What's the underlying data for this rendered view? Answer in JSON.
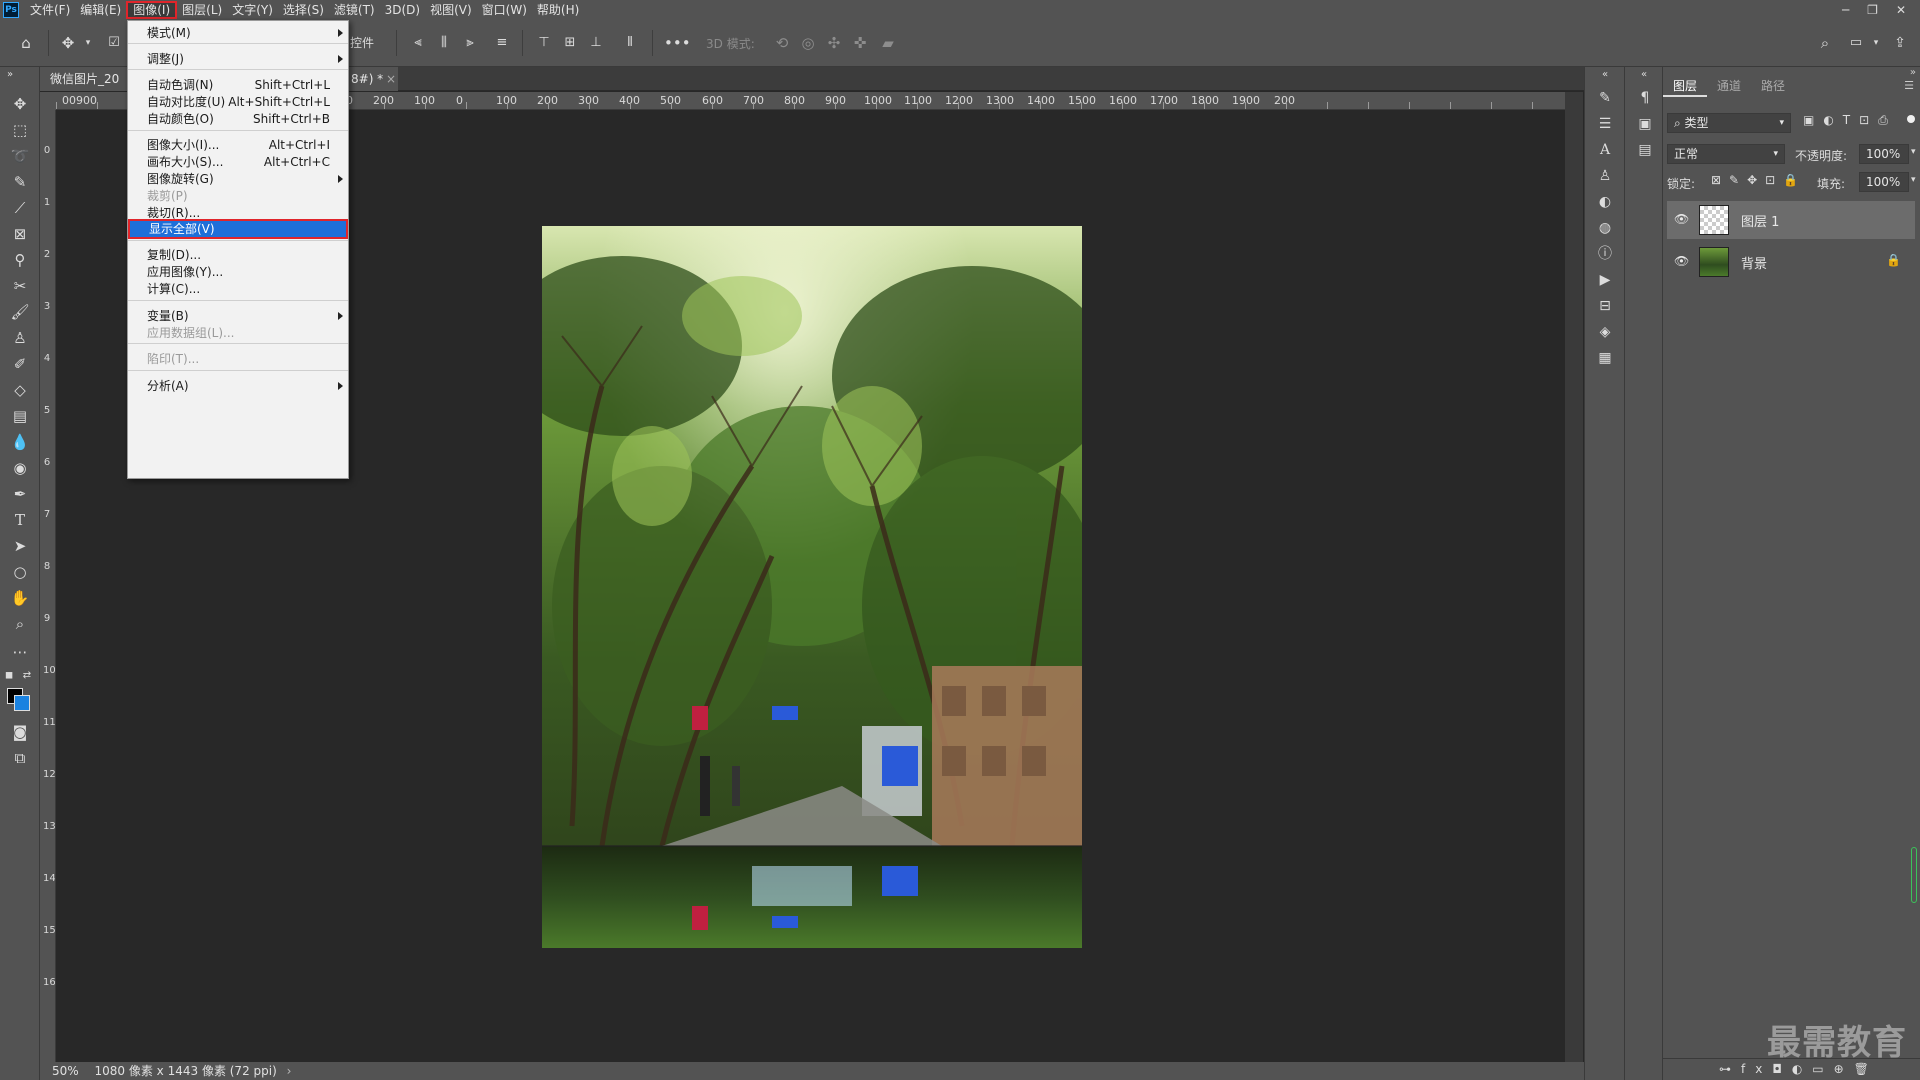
{
  "app": {
    "logo": "Ps"
  },
  "menubar": {
    "items": [
      "文件(F)",
      "编辑(E)",
      "图像(I)",
      "图层(L)",
      "文字(Y)",
      "选择(S)",
      "滤镜(T)",
      "3D(D)",
      "视图(V)",
      "窗口(W)",
      "帮助(H)"
    ],
    "active": "图像(I)"
  },
  "window_controls": {
    "minimize": "─",
    "restore": "❐",
    "close": "✕"
  },
  "options": {
    "partial_label": "控件",
    "mode3d_label": "3D 模式:",
    "more": "•••"
  },
  "tab": {
    "title": "微信图片_20"
  },
  "tab_partial": {
    "suffix": "8#) *",
    "close": "×"
  },
  "ruler": {
    "top_labels": [
      "00",
      "900",
      "300",
      "200",
      "100",
      "0",
      "100",
      "200",
      "300",
      "400",
      "500",
      "600",
      "700",
      "800",
      "900",
      "1000",
      "1100",
      "1200",
      "1300",
      "1400",
      "1500",
      "1600",
      "1700",
      "1800",
      "1900",
      "200"
    ],
    "left_labels": [
      "0",
      "1",
      "2",
      "3",
      "4",
      "5",
      "6",
      "7",
      "8",
      "9",
      "10",
      "11",
      "12",
      "13",
      "14",
      "15",
      "16"
    ]
  },
  "status": {
    "zoom": "50%",
    "info": "1080 像素 x 1443 像素 (72 ppi)"
  },
  "image_menu": {
    "items": [
      {
        "label": "模式(M)",
        "shortcut": "",
        "submenu": true,
        "disabled": false
      },
      {
        "label": "调整(J)",
        "shortcut": "",
        "submenu": true,
        "disabled": false
      },
      {
        "label": "自动色调(N)",
        "shortcut": "Shift+Ctrl+L",
        "submenu": false,
        "disabled": false
      },
      {
        "label": "自动对比度(U)",
        "shortcut": "Alt+Shift+Ctrl+L",
        "submenu": false,
        "disabled": false
      },
      {
        "label": "自动颜色(O)",
        "shortcut": "Shift+Ctrl+B",
        "submenu": false,
        "disabled": false
      },
      {
        "label": "图像大小(I)...",
        "shortcut": "Alt+Ctrl+I",
        "submenu": false,
        "disabled": false
      },
      {
        "label": "画布大小(S)...",
        "shortcut": "Alt+Ctrl+C",
        "submenu": false,
        "disabled": false
      },
      {
        "label": "图像旋转(G)",
        "shortcut": "",
        "submenu": true,
        "disabled": false
      },
      {
        "label": "裁剪(P)",
        "shortcut": "",
        "submenu": false,
        "disabled": true
      },
      {
        "label": "裁切(R)...",
        "shortcut": "",
        "submenu": false,
        "disabled": false
      },
      {
        "label": "显示全部(V)",
        "shortcut": "",
        "submenu": false,
        "disabled": false,
        "highlighted": true
      },
      {
        "label": "复制(D)...",
        "shortcut": "",
        "submenu": false,
        "disabled": false
      },
      {
        "label": "应用图像(Y)...",
        "shortcut": "",
        "submenu": false,
        "disabled": false
      },
      {
        "label": "计算(C)...",
        "shortcut": "",
        "submenu": false,
        "disabled": false
      },
      {
        "label": "变量(B)",
        "shortcut": "",
        "submenu": true,
        "disabled": false
      },
      {
        "label": "应用数据组(L)...",
        "shortcut": "",
        "submenu": false,
        "disabled": true
      },
      {
        "label": "陷印(T)...",
        "shortcut": "",
        "submenu": false,
        "disabled": true
      },
      {
        "label": "分析(A)",
        "shortcut": "",
        "submenu": true,
        "disabled": false
      }
    ]
  },
  "layers_panel": {
    "tabs": [
      "图层",
      "通道",
      "路径"
    ],
    "filter_label": "类型",
    "blend_mode": "正常",
    "opacity_label": "不透明度:",
    "opacity_value": "100%",
    "lock_label": "锁定:",
    "fill_label": "填充:",
    "fill_value": "100%",
    "layers": [
      {
        "name": "图层 1",
        "selected": true,
        "locked": false
      },
      {
        "name": "背景",
        "selected": false,
        "locked": true
      }
    ]
  },
  "watermark": {
    "text": "最需教育"
  },
  "colors": {
    "ui_bg": "#535353",
    "canvas_bg": "#282828",
    "menu_highlight": "#1e6fd9",
    "annotation_red": "#e0252b",
    "background_color_swatch": "#1a82e0",
    "foreground_color_swatch": "#000000"
  }
}
